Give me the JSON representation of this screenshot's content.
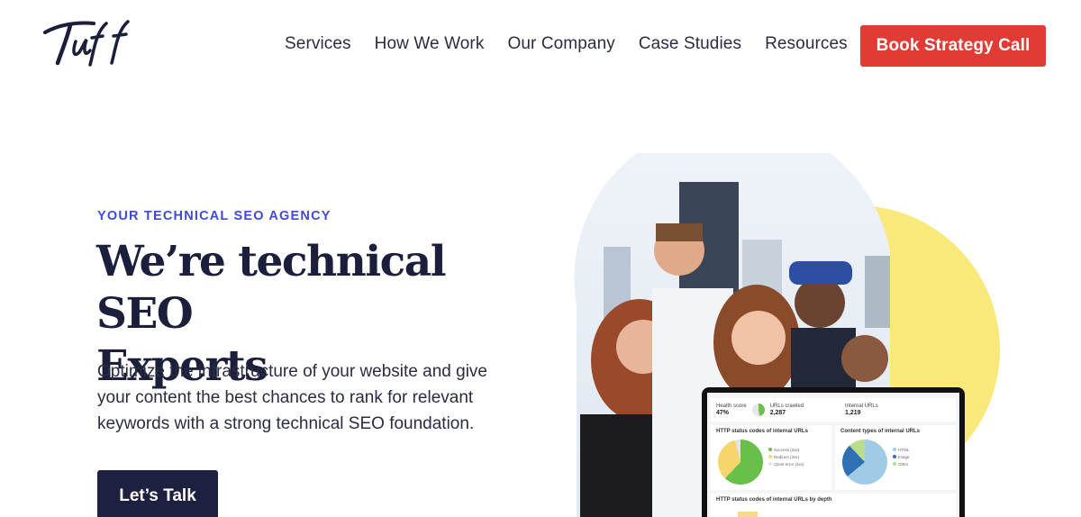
{
  "brand": {
    "logo_text": "Tuff"
  },
  "nav": {
    "links": [
      "Services",
      "How We Work",
      "Our Company",
      "Case Studies",
      "Resources"
    ],
    "cta_label": "Book Strategy Call"
  },
  "hero": {
    "eyebrow": "YOUR TECHNICAL SEO AGENCY",
    "headline_line1": "We’re technical SEO",
    "headline_line2": "Experts",
    "subcopy": "Optimize the infrastructure of your website and give your content the best chances to rank for relevant keywords with a strong technical SEO foundation.",
    "cta_label": "Let’s Talk"
  },
  "dashboard": {
    "stat1_label": "Health score",
    "stat1_value": "47%",
    "stat2_label": "URLs crawled",
    "stat2_value": "2,287",
    "stat3_label": "Internal URLs",
    "stat3_value": "1,219",
    "panel1_title": "HTTP status codes of internal URLs",
    "panel1_legend": [
      "Success (2xx)",
      "Redirect (3xx)",
      "Client error (4xx)"
    ],
    "panel2_title": "Content types of internal URLs",
    "panel2_legend": [
      "HTML",
      "Image",
      "Other"
    ],
    "panel3_title": "HTTP status codes of internal URLs by depth"
  },
  "colors": {
    "accent_red": "#e03b34",
    "navy": "#1e2040",
    "eyebrow_blue": "#3f4bd6",
    "yellow": "#f9e87a"
  }
}
